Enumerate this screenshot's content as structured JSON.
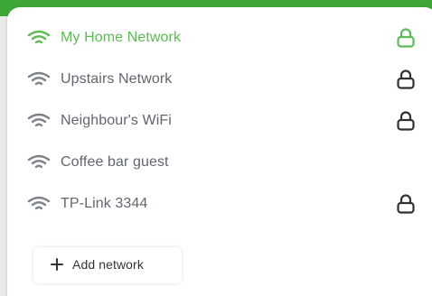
{
  "colors": {
    "accent_green": "#5dbb56",
    "header_green": "#3ea836",
    "text_gray": "#60666d"
  },
  "networks": [
    {
      "label": "My Home Network",
      "locked": true,
      "connected": true,
      "icon": "wifi-icon"
    },
    {
      "label": "Upstairs Network",
      "locked": true,
      "connected": false,
      "icon": "wifi-icon"
    },
    {
      "label": "Neighbour's WiFi",
      "locked": true,
      "connected": false,
      "icon": "wifi-icon"
    },
    {
      "label": "Coffee bar guest",
      "locked": false,
      "connected": false,
      "icon": "wifi-icon"
    },
    {
      "label": "TP-Link 3344",
      "locked": true,
      "connected": false,
      "icon": "wifi-icon"
    }
  ],
  "add_network": {
    "label": "Add network",
    "icon": "plus-icon"
  }
}
